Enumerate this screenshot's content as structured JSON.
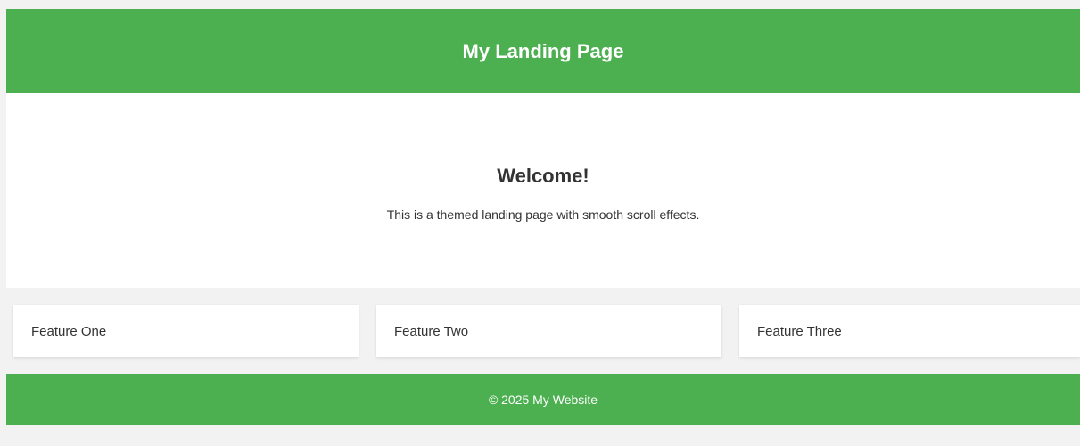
{
  "header": {
    "title": "My Landing Page"
  },
  "hero": {
    "title": "Welcome!",
    "text": "This is a themed landing page with smooth scroll effects."
  },
  "features": [
    {
      "label": "Feature One"
    },
    {
      "label": "Feature Two"
    },
    {
      "label": "Feature Three"
    }
  ],
  "footer": {
    "text": "© 2025 My Website"
  },
  "colors": {
    "brand_green": "#4caf50",
    "page_background": "#f2f2f2",
    "card_background": "#ffffff",
    "text": "#333333"
  }
}
